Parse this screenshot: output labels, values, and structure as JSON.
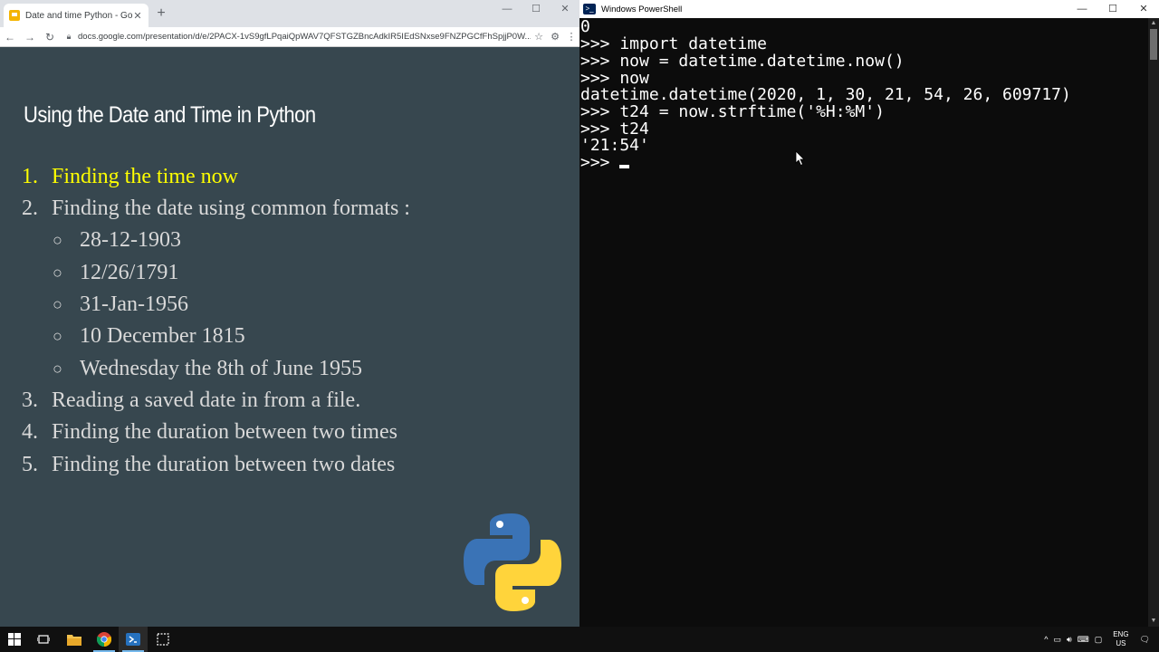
{
  "browser": {
    "tab_title": "Date and time Python - Google Slides",
    "tab_close": "✕",
    "new_tab": "+",
    "url": "docs.google.com/presentation/d/e/2PACX-1vS9gfLPqaiQpWAV7QFSTGZBncAdkIR5IEdSNxse9FNZPGCfFhSpjjP0W...",
    "window_controls": [
      "—",
      "☐",
      "✕"
    ]
  },
  "slide": {
    "title": "Using the Date and Time in Python",
    "items": [
      {
        "num": "1.",
        "text": "Finding the time now",
        "active": true
      },
      {
        "num": "2.",
        "text": "Finding the date using common formats :",
        "active": false
      },
      {
        "num": "○",
        "text": "28-12-1903",
        "sub": true
      },
      {
        "num": "○",
        "text": "12/26/1791",
        "sub": true
      },
      {
        "num": "○",
        "text": "31-Jan-1956",
        "sub": true
      },
      {
        "num": "○",
        "text": "10 December 1815",
        "sub": true
      },
      {
        "num": "○",
        "text": "Wednesday the 8th of June 1955",
        "sub": true
      },
      {
        "num": "3.",
        "text": "Reading a saved date in from a file.",
        "active": false
      },
      {
        "num": "4.",
        "text": "Finding the duration between two times",
        "active": false
      },
      {
        "num": "5.",
        "text": "Finding the duration between two dates",
        "active": false
      }
    ],
    "colors": {
      "background": "#37474f",
      "active": "#ffff00",
      "text": "#d9d9d9"
    }
  },
  "powershell": {
    "title": "Windows PowerShell",
    "window_controls": [
      "—",
      "☐",
      "✕"
    ],
    "lines": [
      "0",
      ">>> import datetime",
      ">>> now = datetime.datetime.now()",
      ">>> now",
      "datetime.datetime(2020, 1, 30, 21, 54, 26, 609717)",
      ">>> t24 = now.strftime('%H:%M')",
      ">>> t24",
      "'21:54'",
      ">>> "
    ]
  },
  "taskbar": {
    "language_line1": "ENG",
    "language_line2": "US",
    "tray_up": "^"
  }
}
